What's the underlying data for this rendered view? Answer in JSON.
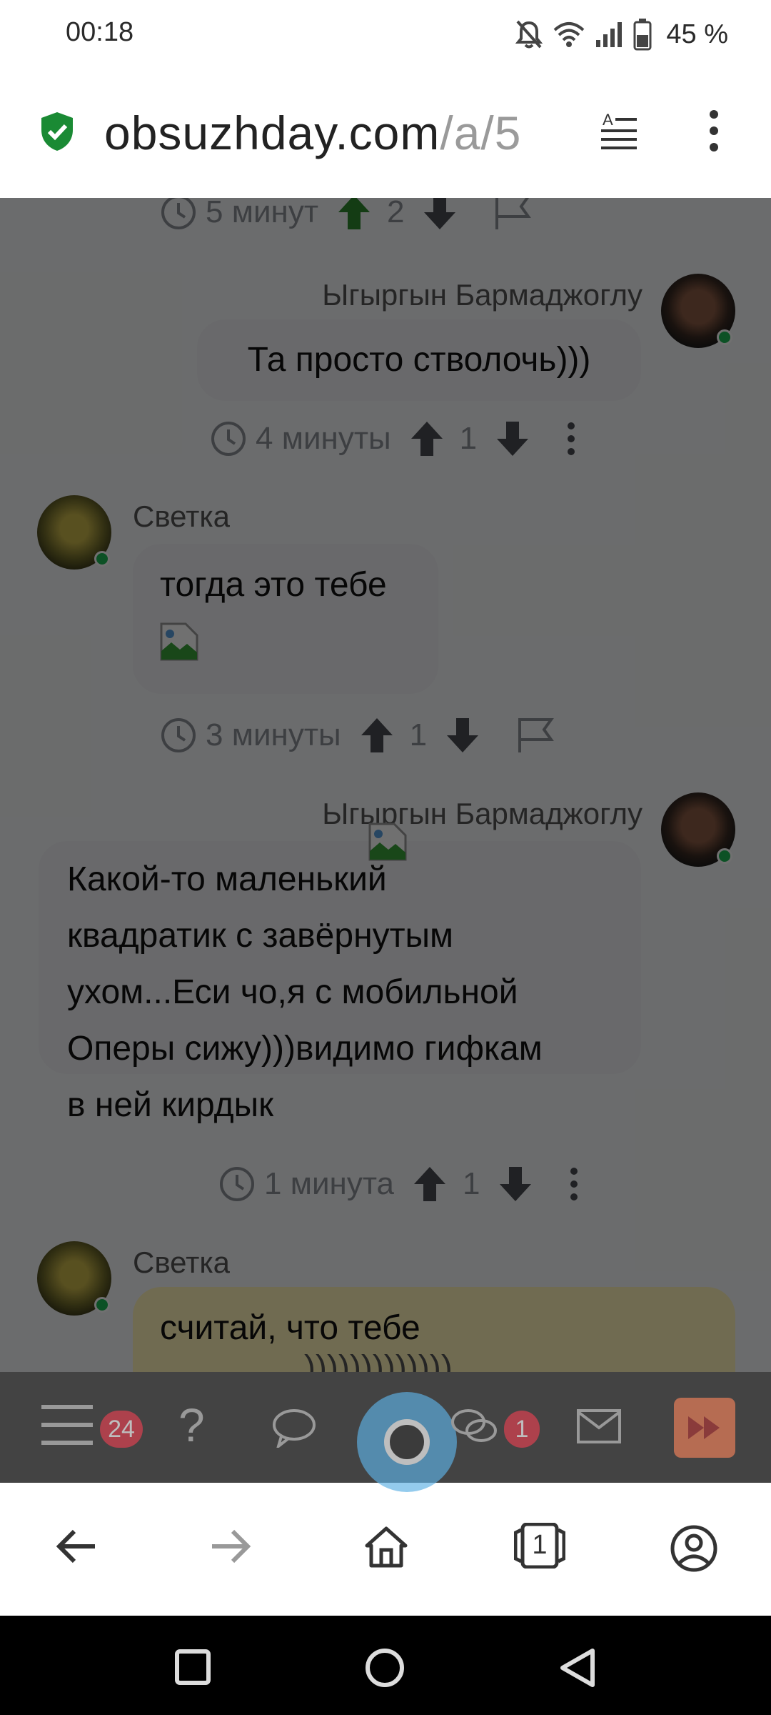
{
  "status": {
    "time": "00:18",
    "battery": "45 %"
  },
  "browser": {
    "url_host": "obsuzhday.com",
    "url_path": "/a/5"
  },
  "comments": [
    {
      "time": "5 минут",
      "votes": "2"
    },
    {
      "author": "Ыгыргын Бармаджоглу",
      "text": "Та просто стволочь)))",
      "time": "4 минуты",
      "votes": "1"
    },
    {
      "author": "Светка",
      "text": "тогда это тебе",
      "time": "3 минуты",
      "votes": "1"
    },
    {
      "author": "Ыгыргын Бармаджоглу",
      "lines": [
        "Какой-то маленький",
        "квадратик с завёрнутым",
        "ухом...Еси чо,я с мобильной",
        "Оперы сижу)))видимо гифкам",
        "в ней кирдык"
      ],
      "time": "1 минута",
      "votes": "1"
    },
    {
      "author": "Светка",
      "text": "считай, что тебе",
      "partial": ")))))))))))))"
    }
  ],
  "site_nav": {
    "notifications": "24",
    "messages": "1"
  },
  "browser_nav": {
    "tabs_count": "1"
  },
  "colors": {
    "accent": "#3ea2e0",
    "upvote_active": "#2f8a2f",
    "badge": "#e01b2f",
    "highlight": "#fff3b8"
  }
}
